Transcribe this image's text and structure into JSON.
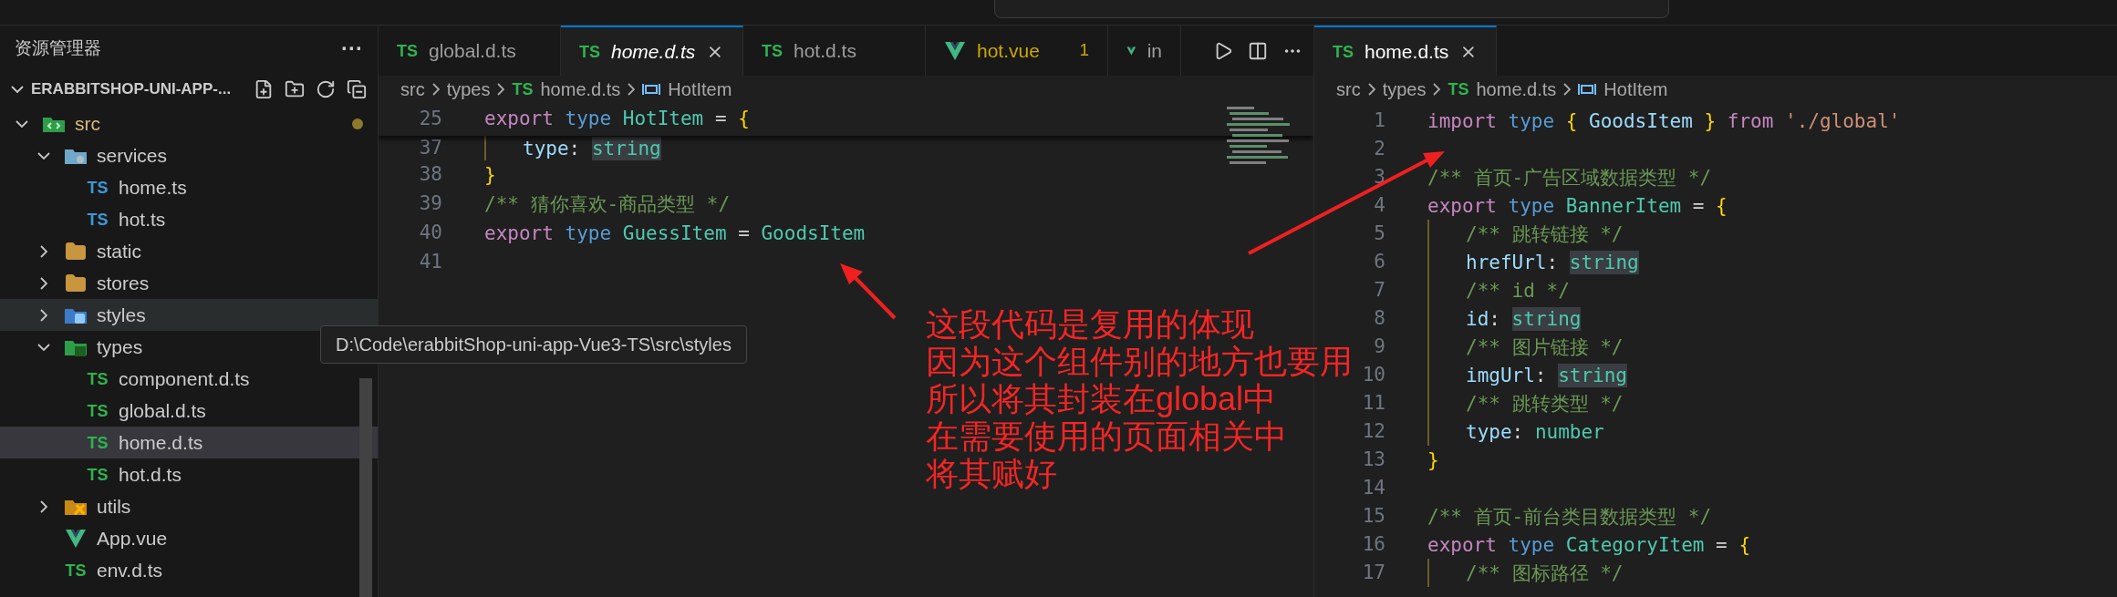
{
  "explorer": {
    "title": "资源管理器",
    "more": "···",
    "section_title": "ERABBITSHOP-UNI-APP-...",
    "tree": [
      {
        "name": "src",
        "kind": "folder-src",
        "expanded": true,
        "selected": false,
        "hovered": false,
        "modified": true,
        "children": [
          {
            "name": "services",
            "kind": "folder-services",
            "expanded": true,
            "selected": false,
            "hovered": false,
            "modified": false,
            "children": [
              {
                "name": "home.ts",
                "kind": "ts",
                "icon": "TS",
                "selected": false,
                "hovered": false,
                "modified": false
              },
              {
                "name": "hot.ts",
                "kind": "ts",
                "icon": "TS",
                "selected": false,
                "hovered": false,
                "modified": false
              }
            ]
          },
          {
            "name": "static",
            "kind": "folder",
            "expanded": false,
            "selected": false,
            "hovered": false,
            "modified": false
          },
          {
            "name": "stores",
            "kind": "folder",
            "expanded": false,
            "selected": false,
            "hovered": false,
            "modified": false
          },
          {
            "name": "styles",
            "kind": "folder-styles",
            "expanded": false,
            "selected": false,
            "hovered": true,
            "modified": false
          },
          {
            "name": "types",
            "kind": "folder-types",
            "expanded": true,
            "selected": false,
            "hovered": false,
            "modified": false,
            "children": [
              {
                "name": "component.d.ts",
                "kind": "ts-d",
                "icon": "TS",
                "selected": false,
                "hovered": false,
                "modified": false
              },
              {
                "name": "global.d.ts",
                "kind": "ts-d",
                "icon": "TS",
                "selected": false,
                "hovered": false,
                "modified": false
              },
              {
                "name": "home.d.ts",
                "kind": "ts-d",
                "icon": "TS",
                "selected": true,
                "hovered": false,
                "modified": false
              },
              {
                "name": "hot.d.ts",
                "kind": "ts-d",
                "icon": "TS",
                "selected": false,
                "hovered": false,
                "modified": false
              }
            ]
          },
          {
            "name": "utils",
            "kind": "folder-utils",
            "expanded": false,
            "selected": false,
            "hovered": false,
            "modified": false
          },
          {
            "name": "App.vue",
            "kind": "vue",
            "selected": false,
            "hovered": false,
            "modified": false
          },
          {
            "name": "env.d.ts",
            "kind": "ts-d",
            "icon": "TS",
            "selected": false,
            "hovered": false,
            "modified": false
          }
        ]
      }
    ]
  },
  "tooltip": {
    "text": "D:\\Code\\erabbitShop-uni-app-Vue3-TS\\src\\styles"
  },
  "editors": [
    {
      "tabs": [
        {
          "label": "global.d.ts",
          "icon": "TS",
          "kind": "ts",
          "selected": false,
          "preview": false,
          "warning": false
        },
        {
          "label": "home.d.ts",
          "icon": "TS",
          "kind": "ts",
          "selected": true,
          "preview": true,
          "warning": false
        },
        {
          "label": "hot.d.ts",
          "icon": "TS",
          "kind": "ts",
          "selected": false,
          "preview": false,
          "warning": false
        },
        {
          "label": "hot.vue",
          "kind": "vue",
          "selected": false,
          "preview": false,
          "warning": true,
          "badge": "1"
        },
        {
          "label": "in",
          "kind": "vue",
          "selected": false,
          "preview": false,
          "warning": false
        }
      ],
      "actions": true,
      "breadcrumb": [
        {
          "text": "src",
          "kind": "folder"
        },
        {
          "text": "types",
          "kind": "folder"
        },
        {
          "text": "home.d.ts",
          "icon": "TS",
          "kind": "file"
        },
        {
          "text": "HotItem",
          "kind": "symbol"
        }
      ],
      "sticky": {
        "number": "25",
        "tokens": [
          {
            "text": "export ",
            "kind": "keyword"
          },
          {
            "text": "type ",
            "kind": "type-kw"
          },
          {
            "text": "HotItem",
            "kind": "type"
          },
          {
            "text": " = ",
            "kind": "punct"
          },
          {
            "text": "{",
            "kind": "brace"
          }
        ]
      },
      "lines": [
        {
          "number": "37",
          "guide": true,
          "tokens": [
            {
              "text": "type",
              "kind": "prop"
            },
            {
              "text": ": ",
              "kind": "punct"
            },
            {
              "text": "string",
              "kind": "type-hl"
            }
          ]
        },
        {
          "number": "38",
          "guide": false,
          "tokens": [
            {
              "text": "}",
              "kind": "brace"
            }
          ]
        },
        {
          "number": "39",
          "guide": false,
          "tokens": [
            {
              "text": "/** 猜你喜欢-商品类型 */",
              "kind": "comment"
            }
          ]
        },
        {
          "number": "40",
          "guide": false,
          "tokens": [
            {
              "text": "export ",
              "kind": "keyword"
            },
            {
              "text": "type ",
              "kind": "type-kw"
            },
            {
              "text": "GuessItem",
              "kind": "type"
            },
            {
              "text": " = ",
              "kind": "punct"
            },
            {
              "text": "GoodsItem",
              "kind": "type"
            }
          ]
        },
        {
          "number": "41",
          "guide": false
        }
      ]
    },
    {
      "tabs": [
        {
          "label": "home.d.ts",
          "icon": "TS",
          "kind": "ts",
          "selected": true,
          "preview": false,
          "warning": false
        }
      ],
      "actions": false,
      "breadcrumb": [
        {
          "text": "src",
          "kind": "folder"
        },
        {
          "text": "types",
          "kind": "folder"
        },
        {
          "text": "home.d.ts",
          "icon": "TS",
          "kind": "file"
        },
        {
          "text": "HotItem",
          "kind": "symbol"
        }
      ],
      "lines": [
        {
          "number": "1",
          "guide": false,
          "tokens": [
            {
              "text": "import ",
              "kind": "keyword"
            },
            {
              "text": "type ",
              "kind": "type-kw"
            },
            {
              "text": "{ ",
              "kind": "brace"
            },
            {
              "text": "GoodsItem",
              "kind": "prop"
            },
            {
              "text": " }",
              "kind": "brace"
            },
            {
              "text": " from ",
              "kind": "keyword"
            },
            {
              "text": "'./global'",
              "kind": "string"
            }
          ]
        },
        {
          "number": "2",
          "guide": false
        },
        {
          "number": "3",
          "guide": false,
          "tokens": [
            {
              "text": "/** 首页-广告区域数据类型 */",
              "kind": "comment"
            }
          ]
        },
        {
          "number": "4",
          "guide": false,
          "tokens": [
            {
              "text": "export ",
              "kind": "keyword"
            },
            {
              "text": "type ",
              "kind": "type-kw"
            },
            {
              "text": "BannerItem",
              "kind": "type"
            },
            {
              "text": " = ",
              "kind": "punct"
            },
            {
              "text": "{",
              "kind": "brace"
            }
          ]
        },
        {
          "number": "5",
          "guide": true,
          "tokens": [
            {
              "text": "/** 跳转链接 */",
              "kind": "comment"
            }
          ]
        },
        {
          "number": "6",
          "guide": true,
          "tokens": [
            {
              "text": "hrefUrl",
              "kind": "prop"
            },
            {
              "text": ": ",
              "kind": "punct"
            },
            {
              "text": "string",
              "kind": "type-hl"
            }
          ]
        },
        {
          "number": "7",
          "guide": true,
          "tokens": [
            {
              "text": "/** id */",
              "kind": "comment"
            }
          ]
        },
        {
          "number": "8",
          "guide": true,
          "tokens": [
            {
              "text": "id",
              "kind": "prop"
            },
            {
              "text": ": ",
              "kind": "punct"
            },
            {
              "text": "string",
              "kind": "type-hl"
            }
          ]
        },
        {
          "number": "9",
          "guide": true,
          "tokens": [
            {
              "text": "/** 图片链接 */",
              "kind": "comment"
            }
          ]
        },
        {
          "number": "10",
          "guide": true,
          "tokens": [
            {
              "text": "imgUrl",
              "kind": "prop"
            },
            {
              "text": ": ",
              "kind": "punct"
            },
            {
              "text": "string",
              "kind": "type-hl"
            }
          ]
        },
        {
          "number": "11",
          "guide": true,
          "tokens": [
            {
              "text": "/** 跳转类型 */",
              "kind": "comment"
            }
          ]
        },
        {
          "number": "12",
          "guide": true,
          "tokens": [
            {
              "text": "type",
              "kind": "prop"
            },
            {
              "text": ": ",
              "kind": "punct"
            },
            {
              "text": "number",
              "kind": "type"
            }
          ]
        },
        {
          "number": "13",
          "guide": false,
          "tokens": [
            {
              "text": "}",
              "kind": "brace"
            }
          ]
        },
        {
          "number": "14",
          "guide": false
        },
        {
          "number": "15",
          "guide": false,
          "tokens": [
            {
              "text": "/** 首页-前台类目数据类型 */",
              "kind": "comment"
            }
          ]
        },
        {
          "number": "16",
          "guide": false,
          "tokens": [
            {
              "text": "export ",
              "kind": "keyword"
            },
            {
              "text": "type ",
              "kind": "type-kw"
            },
            {
              "text": "CategoryItem",
              "kind": "type"
            },
            {
              "text": " = ",
              "kind": "punct"
            },
            {
              "text": "{",
              "kind": "brace"
            }
          ]
        },
        {
          "number": "17",
          "guide": true,
          "tokens": [
            {
              "text": "/** 图标路径 */",
              "kind": "comment"
            }
          ]
        }
      ]
    }
  ],
  "annotation": {
    "lines": [
      "这段代码是复用的体现",
      "因为这个组件别的地方也要用",
      "所以将其封装在global中",
      "在需要使用的页面相关中",
      "将其赋好"
    ]
  }
}
